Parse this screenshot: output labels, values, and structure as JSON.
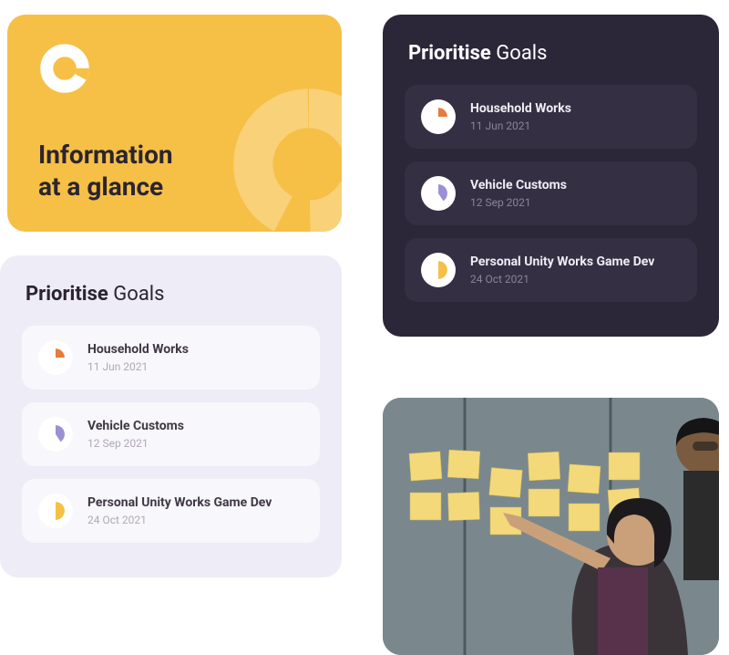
{
  "yellow_card": {
    "headline_line1": "Information",
    "headline_line2": "at a glance"
  },
  "light_panel": {
    "title_bold": "Prioritise",
    "title_rest": "Goals",
    "items": [
      {
        "title": "Household Works",
        "date": "11 Jun 2021",
        "icon": "pie-orange"
      },
      {
        "title": "Vehicle Customs",
        "date": "12 Sep 2021",
        "icon": "pie-purple"
      },
      {
        "title": "Personal Unity Works Game Dev",
        "date": "24 Oct 2021",
        "icon": "pie-yellow"
      }
    ]
  },
  "dark_panel": {
    "title_bold": "Prioritise",
    "title_rest": "Goals",
    "items": [
      {
        "title": "Household Works",
        "date": "11 Jun 2021",
        "icon": "pie-orange"
      },
      {
        "title": "Vehicle Customs",
        "date": "12 Sep 2021",
        "icon": "pie-purple"
      },
      {
        "title": "Personal Unity Works Game Dev",
        "date": "24 Oct 2021",
        "icon": "pie-yellow"
      }
    ]
  },
  "colors": {
    "orange": "#e77a3c",
    "purple": "#9d8fd6",
    "yellow": "#f6c046"
  }
}
